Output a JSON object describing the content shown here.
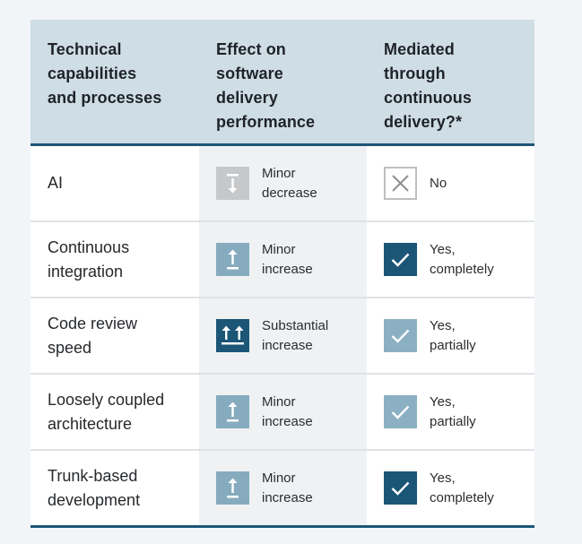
{
  "colors": {
    "page_bg": "#f1f5f8",
    "header_bg": "#cfdde5",
    "accent_dark": "#1b5677",
    "accent_light": "#86abbe",
    "neutral_icon": "#c6c8ca"
  },
  "header": {
    "col1": [
      "Technical",
      "capabilities",
      "and processes"
    ],
    "col2": [
      "Effect on",
      "software",
      "delivery",
      "performance"
    ],
    "col3": [
      "Mediated",
      "through",
      "continuous",
      "delivery?*"
    ]
  },
  "rows": [
    {
      "capability": [
        "AI"
      ],
      "effect": {
        "icon": "minor-decrease-icon",
        "label": [
          "Minor",
          "decrease"
        ]
      },
      "mediated": {
        "icon": "no-x-icon",
        "label": [
          "No"
        ]
      }
    },
    {
      "capability": [
        "Continuous",
        "integration"
      ],
      "effect": {
        "icon": "minor-increase-icon",
        "label": [
          "Minor",
          "increase"
        ]
      },
      "mediated": {
        "icon": "check-complete-icon",
        "label": [
          "Yes,",
          "completely"
        ]
      }
    },
    {
      "capability": [
        "Code review",
        "speed"
      ],
      "effect": {
        "icon": "substantial-increase-icon",
        "label": [
          "Substantial",
          "increase"
        ]
      },
      "mediated": {
        "icon": "check-partial-icon",
        "label": [
          "Yes,",
          "partially"
        ]
      }
    },
    {
      "capability": [
        "Loosely coupled",
        "architecture"
      ],
      "effect": {
        "icon": "minor-increase-icon",
        "label": [
          "Minor",
          "increase"
        ]
      },
      "mediated": {
        "icon": "check-partial-icon",
        "label": [
          "Yes,",
          "partially"
        ]
      }
    },
    {
      "capability": [
        "Trunk-based",
        "development"
      ],
      "effect": {
        "icon": "minor-increase-icon",
        "label": [
          "Minor",
          "increase"
        ]
      },
      "mediated": {
        "icon": "check-complete-icon",
        "label": [
          "Yes,",
          "completely"
        ]
      }
    }
  ]
}
